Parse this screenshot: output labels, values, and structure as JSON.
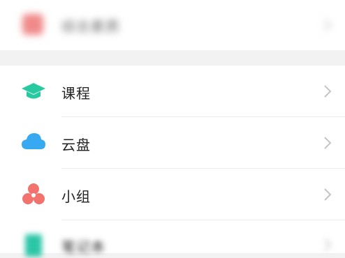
{
  "top_row": {
    "label": "综合素质"
  },
  "menu": {
    "items": [
      {
        "key": "course",
        "label": "课程",
        "icon": "graduation-cap-icon",
        "color": "#27c9a0"
      },
      {
        "key": "cloud",
        "label": "云盘",
        "icon": "cloud-icon",
        "color": "#36a9f0"
      },
      {
        "key": "group",
        "label": "小组",
        "icon": "group-icon",
        "color": "#f2726e"
      },
      {
        "key": "notes",
        "label": "笔记本",
        "icon": "notebook-icon",
        "color": "#2cc6a7"
      }
    ]
  }
}
